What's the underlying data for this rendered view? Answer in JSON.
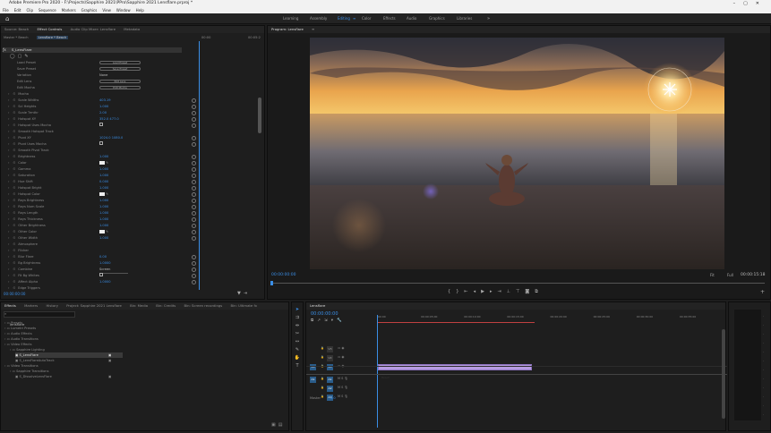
{
  "titlebar": {
    "title": "Adobe Premiere Pro 2020 - F:\\Projects\\Sapphire 2021\\PPro\\Sapphire 2021 Lensflare.prproj *"
  },
  "menu": [
    "File",
    "Edit",
    "Clip",
    "Sequence",
    "Markers",
    "Graphics",
    "View",
    "Window",
    "Help"
  ],
  "workspaces": [
    "Learning",
    "Assembly",
    "Editing",
    "Color",
    "Effects",
    "Audio",
    "Graphics",
    "Libraries"
  ],
  "workspace_active": "Editing",
  "effect_controls": {
    "tabs": [
      "Source: Beach",
      "Effect Controls",
      "Audio Clip Mixer: Lensflare",
      "Metadata"
    ],
    "header_clip": "Master * Beach",
    "header_seq": "Lensflare * Beach",
    "time_start": "00:00",
    "time_end": "00:05:2",
    "effect_name": "S_LensFlare",
    "buttons": [
      {
        "label": "Load Preset",
        "btn": "Load Preset"
      },
      {
        "label": "Save Preset",
        "btn": "Save Preset"
      },
      {
        "label": "Variation",
        "val": "None"
      },
      {
        "label": "Edit Lens",
        "btn": "Edit Lens"
      },
      {
        "label": "Edit Mocha",
        "btn": "Edit Mocha"
      }
    ],
    "params": [
      {
        "label": "Mocha",
        "val": ""
      },
      {
        "label": "Scale Widths",
        "val": "403.19"
      },
      {
        "label": "Scl Heights",
        "val": "1.000"
      },
      {
        "label": "Scale Trmthr",
        "val": "2.00"
      },
      {
        "label": "Hotspot XY",
        "val": "352.0    477.0"
      },
      {
        "label": "Hotspot Uses Mocha",
        "val": "check"
      },
      {
        "label": "Smooth Hotspot Track",
        "val": ""
      },
      {
        "label": "Pivot XY",
        "val": "1024.0    1080.0"
      },
      {
        "label": "Pivot Uses Mocha",
        "val": "check"
      },
      {
        "label": "Smooth Pivot Track",
        "val": ""
      },
      {
        "label": "Brightness",
        "val": "1.000"
      },
      {
        "label": "Color",
        "val": "swatch"
      },
      {
        "label": "Gamma",
        "val": "1.000"
      },
      {
        "label": "Saturation",
        "val": "1.000"
      },
      {
        "label": "Hue Shift",
        "val": "0.000"
      },
      {
        "label": "Hotspot Bright",
        "val": "1.000"
      },
      {
        "label": "Hotspot Color",
        "val": "swatch"
      },
      {
        "label": "Rays Brightness",
        "val": "1.000"
      },
      {
        "label": "Rays Num Scale",
        "val": "1.000"
      },
      {
        "label": "Rays Length",
        "val": "1.000"
      },
      {
        "label": "Rays Thickness",
        "val": "1.000"
      },
      {
        "label": "Other Brightness",
        "val": "1.000"
      },
      {
        "label": "Other Color",
        "val": "swatch"
      },
      {
        "label": "Other Width",
        "val": "1.000"
      },
      {
        "label": "Atmosphere",
        "val": ""
      },
      {
        "label": "Flicker",
        "val": ""
      },
      {
        "label": "Blur Flare",
        "val": "0.00"
      },
      {
        "label": "Bg Brightness",
        "val": "1.0000"
      },
      {
        "label": "Combine",
        "val": "Screen"
      },
      {
        "label": "Fit Bg Whites",
        "val": "check"
      },
      {
        "label": "Affect Alpha",
        "val": "1.0000"
      },
      {
        "label": "Edge Triggers",
        "val": ""
      }
    ],
    "timecode": "00:00:00:00"
  },
  "program": {
    "title": "Program: Lensflare",
    "timecode": "00:00:00:00",
    "fit": "Fit",
    "full": "Full",
    "duration": "00:00:15:18"
  },
  "effects_panel": {
    "tabs": [
      "Effects",
      "Markers",
      "History",
      "Project: Sapphire 2021 Lensflare",
      "Bin: Media",
      "Bin: Credits",
      "Bin: Screen recordings",
      "Bin: Ultimate fx"
    ],
    "search": "lensflare",
    "items": [
      {
        "label": "Presets",
        "indent": 0
      },
      {
        "label": "Lumetri Presets",
        "indent": 0
      },
      {
        "label": "Audio Effects",
        "indent": 0
      },
      {
        "label": "Audio Transitions",
        "indent": 0
      },
      {
        "label": "Video Effects",
        "indent": 0
      },
      {
        "label": "Sapphire Lighting",
        "indent": 1
      },
      {
        "label": "S_LensFlare",
        "indent": 2,
        "selected": true
      },
      {
        "label": "S_LensFlareAutoTrack",
        "indent": 2
      },
      {
        "label": "Video Transitions",
        "indent": 0
      },
      {
        "label": "Sapphire Transitions",
        "indent": 1
      },
      {
        "label": "S_DissolveLensFlare",
        "indent": 2
      }
    ]
  },
  "timeline": {
    "tab": "Lensflare",
    "timecode": "00:00:00:00",
    "ruler": [
      "00:00",
      "00:00:05:00",
      "00:00:10:00",
      "00:00:15:00",
      "00:00:20:00",
      "00:00:25:00",
      "00:00:30:00",
      "00:00:35:00"
    ],
    "video_tracks": [
      "V3",
      "V2",
      "V1"
    ],
    "audio_tracks": [
      "A1",
      "A2",
      "A3"
    ],
    "master": "Master",
    "master_val": "0.0",
    "clip_name": "Beach",
    "source_v": "V1",
    "source_a": "A1"
  },
  "colors": {
    "accent": "#3a8ee6",
    "clip": "#b59ae0",
    "playhead": "#3a8ee6"
  }
}
